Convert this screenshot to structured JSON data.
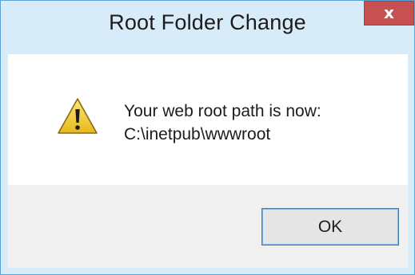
{
  "window": {
    "title": "Root Folder Change",
    "close_glyph": "x"
  },
  "message": {
    "icon": "warning-icon",
    "line1": "Your web root path is now:",
    "line2": "C:\\inetpub\\wwwroot"
  },
  "buttons": {
    "ok_label": "OK"
  },
  "colors": {
    "frame": "#d7ebf9",
    "close_button": "#c75050",
    "footer": "#f0f0f0",
    "ok_border": "#3c7fb1",
    "warning_fill": "#f6d640"
  }
}
